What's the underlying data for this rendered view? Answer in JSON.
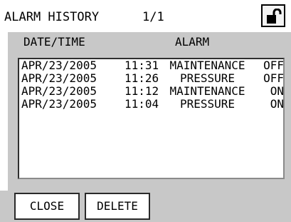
{
  "header": {
    "title": "ALARM HISTORY",
    "page": "1/1",
    "lock_icon": "unlocked-padlock-icon"
  },
  "table": {
    "columns": [
      "DATE/TIME",
      "ALARM"
    ],
    "rows": [
      {
        "date": "APR/23/2005",
        "time": "11:31",
        "alarm": "MAINTENANCE",
        "state": "OFF"
      },
      {
        "date": "APR/23/2005",
        "time": "11:26",
        "alarm": "PRESSURE",
        "state": "OFF"
      },
      {
        "date": "APR/23/2005",
        "time": "11:12",
        "alarm": "MAINTENANCE",
        "state": "ON"
      },
      {
        "date": "APR/23/2005",
        "time": "11:04",
        "alarm": "PRESSURE",
        "state": "ON"
      }
    ]
  },
  "footer": {
    "close_label": "CLOSE",
    "delete_label": "DELETE"
  },
  "colors": {
    "panel": "#c8c8c8",
    "list_background": "#ffffff",
    "text": "#000000"
  }
}
